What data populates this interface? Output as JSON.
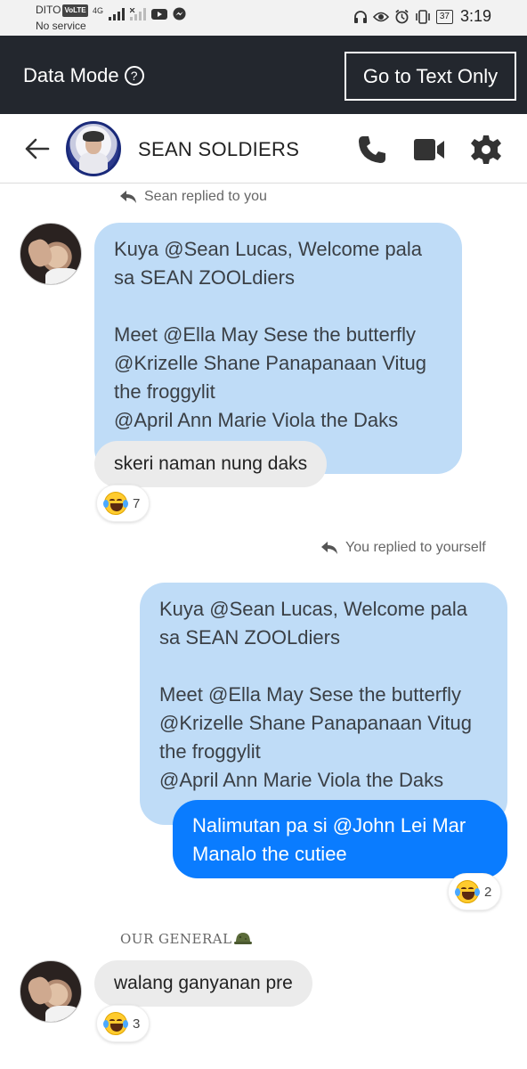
{
  "status_bar": {
    "carrier": "DITO",
    "volte": "VoLTE",
    "sub": "No service",
    "network": "4G",
    "battery": "37",
    "time": "3:19"
  },
  "banner": {
    "label": "Data Mode",
    "help": "?",
    "text_only_button": "Go to Text Only"
  },
  "header": {
    "group_name": "SEAN SOLDIERS"
  },
  "messages": {
    "m1": {
      "reply_note": "Sean replied to you",
      "quoted_text": "Kuya @Sean Lucas, Welcome pala\nsa SEAN ZOOLdiers\n\nMeet @Ella May Sese the butterfly\n@Krizelle Shane Panapanaan Vitug\nthe froggylit\n@April Ann Marie Viola the Daks",
      "reply_text": "skeri naman nung daks",
      "reaction_count": "7"
    },
    "m2": {
      "reply_note": "You replied to yourself",
      "quoted_text": "Kuya @Sean Lucas, Welcome pala\nsa SEAN ZOOLdiers\n\nMeet @Ella May Sese the butterfly\n@Krizelle Shane Panapanaan Vitug\nthe froggylit\n@April Ann Marie Viola the Daks",
      "reply_text": "Nalimutan pa si @John Lei Mar\nManalo the cutiee",
      "reaction_count": "2"
    },
    "m3": {
      "sender": "OUR GENERAL",
      "text": "walang ganyanan pre",
      "reaction_count": "3"
    }
  },
  "colors": {
    "banner_bg": "#23272e",
    "quote_bubble": "#bfdcf7",
    "own_bubble": "#0a7cff",
    "other_bubble": "#ebebeb"
  }
}
